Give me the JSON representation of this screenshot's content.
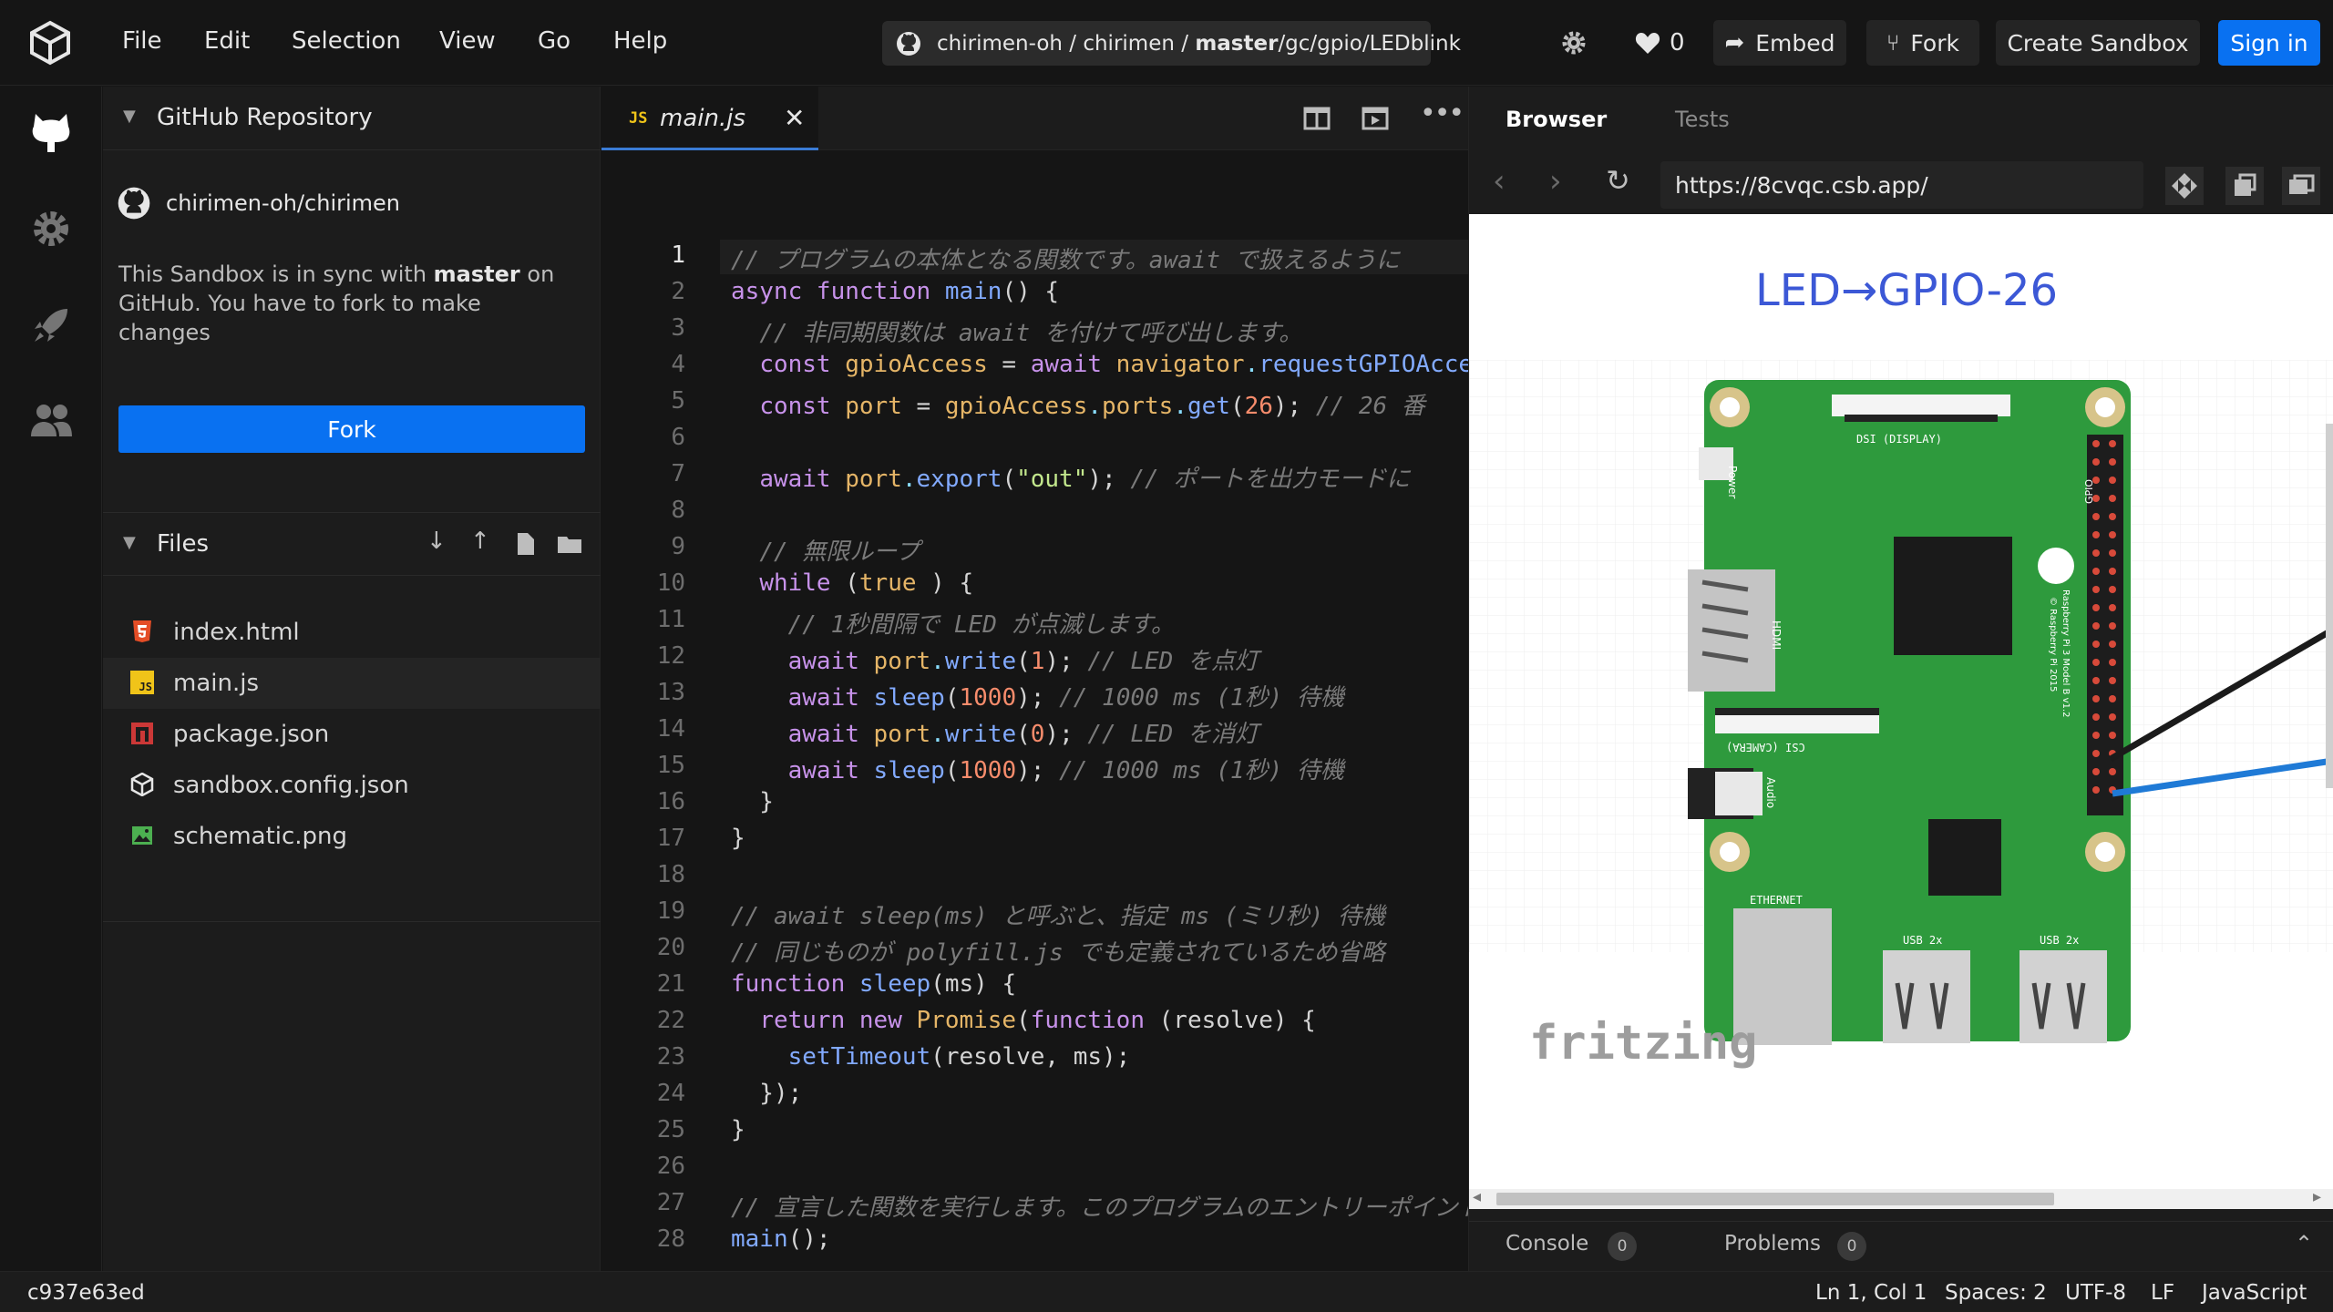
{
  "menubar": {
    "items": [
      "File",
      "Edit",
      "Selection",
      "View",
      "Go",
      "Help"
    ],
    "repo_path_prefix": "chirimen-oh / chirimen / ",
    "repo_path_branch": "master",
    "repo_path_suffix": " /gc/gpio/LEDblink",
    "likes": "0",
    "embed_label": "Embed",
    "fork_label": "Fork",
    "create_label": "Create Sandbox",
    "signin_label": "Sign in"
  },
  "sidebar": {
    "github_section_title": "GitHub Repository",
    "repo_name": "chirimen-oh/chirimen",
    "sync_text_1": "This Sandbox is in sync with ",
    "sync_text_bold": "master",
    "sync_text_2": " on GitHub. You have to fork to make changes",
    "fork_button": "Fork",
    "files_title": "Files",
    "files": [
      {
        "name": "index.html",
        "icon": "html5-icon"
      },
      {
        "name": "main.js",
        "icon": "js-icon"
      },
      {
        "name": "package.json",
        "icon": "npm-icon"
      },
      {
        "name": "sandbox.config.json",
        "icon": "codesandbox-icon"
      },
      {
        "name": "schematic.png",
        "icon": "image-icon"
      }
    ]
  },
  "editor": {
    "tab_label": "main.js",
    "tab_badge": "JS",
    "line_numbers": [
      "1",
      "2",
      "3",
      "4",
      "5",
      "6",
      "7",
      "8",
      "9",
      "10",
      "11",
      "12",
      "13",
      "14",
      "15",
      "16",
      "17",
      "18",
      "19",
      "20",
      "21",
      "22",
      "23",
      "24",
      "25",
      "26",
      "27",
      "28"
    ]
  },
  "browser": {
    "tabs": [
      "Browser",
      "Tests"
    ],
    "url": "https://8cvqc.csb.app/",
    "page_heading": "LED→GPIO-26",
    "watermark": "fritzing",
    "board_labels": {
      "dsi": "DSI (DISPLAY)",
      "power": "Power",
      "hdmi": "HDMI",
      "csi": "CSI (CAMERA)",
      "audio": "Audio",
      "ethernet": "ETHERNET",
      "usb1": "USB 2x",
      "usb2": "USB 2x",
      "gpio": "GPIO",
      "model": "Raspberry Pi 3 Model B v1.2",
      "copyright": "© Raspberry Pi 2015"
    },
    "console_label": "Console",
    "console_count": "0",
    "problems_label": "Problems",
    "problems_count": "0"
  },
  "statusbar": {
    "commit": "c937e63ed",
    "position": "Ln 1, Col 1",
    "spaces": "Spaces: 2",
    "encoding": "UTF-8",
    "eol": "LF",
    "language": "JavaScript"
  },
  "colors": {
    "accent": "#0971f1",
    "background": "#151515"
  }
}
